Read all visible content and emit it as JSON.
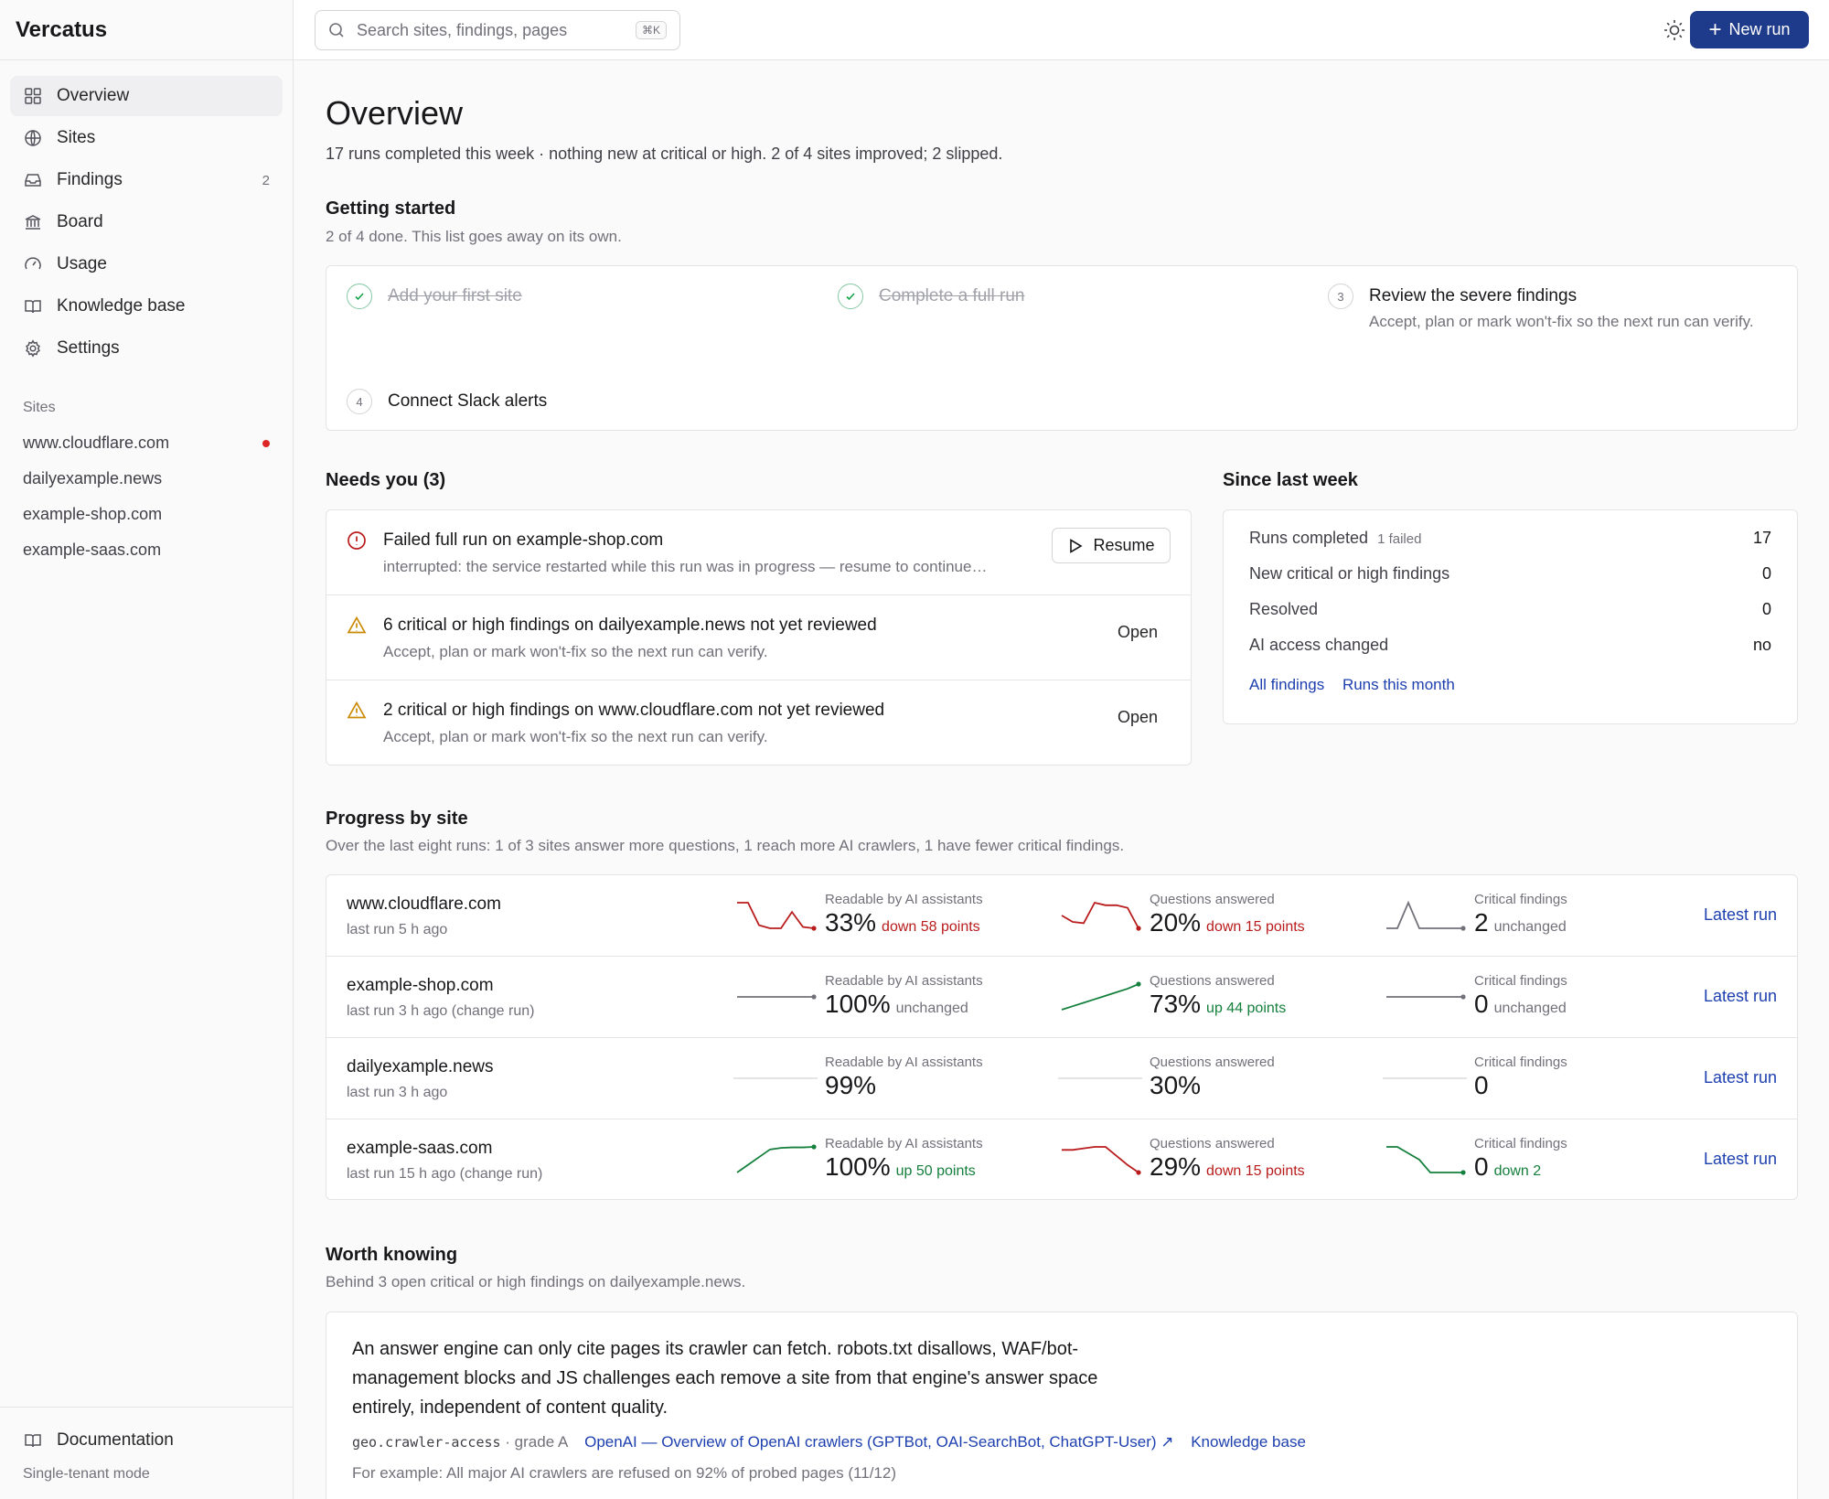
{
  "app": {
    "name": "Vercatus"
  },
  "sidebar": {
    "nav": [
      {
        "label": "Overview",
        "icon": "grid-icon"
      },
      {
        "label": "Sites",
        "icon": "globe-icon"
      },
      {
        "label": "Findings",
        "icon": "inbox-icon",
        "count": "2"
      },
      {
        "label": "Board",
        "icon": "building-icon"
      },
      {
        "label": "Usage",
        "icon": "gauge-icon"
      },
      {
        "label": "Knowledge base",
        "icon": "book-icon"
      },
      {
        "label": "Settings",
        "icon": "gear-icon"
      }
    ],
    "sites_label": "Sites",
    "sites": [
      "www.cloudflare.com",
      "dailyexample.news",
      "example-shop.com",
      "example-saas.com"
    ],
    "documentation": "Documentation",
    "mode": "Single-tenant mode"
  },
  "topbar": {
    "search_placeholder": "Search sites, findings, pages",
    "search_shortcut": "⌘K",
    "new_run": "New run"
  },
  "overview": {
    "title": "Overview",
    "summary": "17 runs completed this week · nothing new at critical or high. 2 of 4 sites improved; 2 slipped."
  },
  "getting_started": {
    "title": "Getting started",
    "subtitle": "2 of 4 done. This list goes away on its own.",
    "steps": [
      {
        "num": "1",
        "title": "Add your first site",
        "done": true
      },
      {
        "num": "2",
        "title": "Complete a full run",
        "done": true
      },
      {
        "num": "3",
        "title": "Review the severe findings",
        "desc": "Accept, plan or mark won't-fix so the next run can verify.",
        "done": false
      },
      {
        "num": "4",
        "title": "Connect Slack alerts",
        "done": false
      }
    ]
  },
  "needs_you": {
    "title": "Needs you (3)",
    "items": [
      {
        "title": "Failed full run on example-shop.com",
        "desc": "interrupted: the service restarted while this run was in progress — resume to continue…",
        "action": "Resume",
        "icon": "alert-circle-icon"
      },
      {
        "title": "6 critical or high findings on dailyexample.news not yet reviewed",
        "desc": "Accept, plan or mark won't-fix so the next run can verify.",
        "action": "Open",
        "icon": "warning-triangle-icon"
      },
      {
        "title": "2 critical or high findings on www.cloudflare.com not yet reviewed",
        "desc": "Accept, plan or mark won't-fix so the next run can verify.",
        "action": "Open",
        "icon": "warning-triangle-icon"
      }
    ]
  },
  "since_last_week": {
    "title": "Since last week",
    "rows": [
      {
        "label": "Runs completed",
        "note": "1 failed",
        "value": "17"
      },
      {
        "label": "New critical or high findings",
        "note": "",
        "value": "0"
      },
      {
        "label": "Resolved",
        "note": "",
        "value": "0"
      },
      {
        "label": "AI access changed",
        "note": "",
        "value": "no"
      }
    ],
    "links": [
      "All findings",
      "Runs this month"
    ]
  },
  "progress": {
    "title": "Progress by site",
    "subtitle": "Over the last eight runs: 1 of 3 sites answer more questions, 1 reach more AI crawlers, 1 have fewer critical findings.",
    "metric_labels": [
      "Readable by AI assistants",
      "Questions answered",
      "Critical findings"
    ],
    "latest_label": "Latest run",
    "rows": [
      {
        "site": "www.cloudflare.com",
        "meta": "last run 5 h ago",
        "metrics": [
          {
            "value": "33%",
            "change": "down 58 points",
            "trend": "down",
            "spark": [
              91,
              91,
              40,
              33,
              33,
              70,
              36,
              33
            ]
          },
          {
            "value": "20%",
            "change": "down 15 points",
            "trend": "down",
            "spark": [
              30,
              25,
              24,
              40,
              38,
              38,
              36,
              20
            ]
          },
          {
            "value": "2",
            "change": "unchanged",
            "trend": "same",
            "spark": [
              2,
              2,
              3,
              2,
              2,
              2,
              2,
              2
            ]
          }
        ]
      },
      {
        "site": "example-shop.com",
        "meta": "last run 3 h ago (change run)",
        "metrics": [
          {
            "value": "100%",
            "change": "unchanged",
            "trend": "same",
            "spark": [
              100,
              100,
              100,
              100,
              100,
              100,
              100,
              100
            ]
          },
          {
            "value": "73%",
            "change": "up 44 points",
            "trend": "up",
            "spark": [
              29,
              35,
              41,
              47,
              53,
              59,
              65,
              73
            ]
          },
          {
            "value": "0",
            "change": "unchanged",
            "trend": "same",
            "spark": [
              0,
              0,
              0,
              0,
              0,
              0,
              0,
              0
            ]
          }
        ]
      },
      {
        "site": "dailyexample.news",
        "meta": "last run 3 h ago",
        "metrics": [
          {
            "value": "99%",
            "change": "",
            "trend": "flat",
            "spark": []
          },
          {
            "value": "30%",
            "change": "",
            "trend": "flat",
            "spark": []
          },
          {
            "value": "0",
            "change": "",
            "trend": "flat",
            "spark": []
          }
        ]
      },
      {
        "site": "example-saas.com",
        "meta": "last run 15 h ago (change run)",
        "metrics": [
          {
            "value": "100%",
            "change": "up 50 points",
            "trend": "up",
            "spark": [
              50,
              65,
              80,
              95,
              98,
              99,
              99,
              100
            ]
          },
          {
            "value": "29%",
            "change": "down 15 points",
            "trend": "down",
            "spark": [
              44,
              44,
              45,
              46,
              46,
              40,
              34,
              29
            ]
          },
          {
            "value": "0",
            "change": "down 2",
            "trend": "up",
            "spark": [
              2,
              2,
              1.5,
              1,
              0,
              0,
              0,
              0
            ]
          }
        ]
      }
    ]
  },
  "worth_knowing": {
    "title": "Worth knowing",
    "subtitle": "Behind 3 open critical or high findings on dailyexample.news.",
    "text": "An answer engine can only cite pages its crawler can fetch. robots.txt disallows, WAF/bot-management blocks and JS challenges each remove a site from that engine's answer space entirely, independent of content quality.",
    "code": "geo.crawler-access",
    "grade": "· grade A",
    "source_link": "OpenAI — Overview of OpenAI crawlers (GPTBot, OAI-SearchBot, ChatGPT-User) ↗",
    "kb_link": "Knowledge base",
    "example": "For example: All major AI crawlers are refused on 92% of probed pages (11/12)"
  },
  "colors": {
    "accent": "#1e3a8a",
    "link": "#1e40af",
    "up": "#15803d",
    "down": "#b91c1c",
    "neutral": "#71717a"
  }
}
